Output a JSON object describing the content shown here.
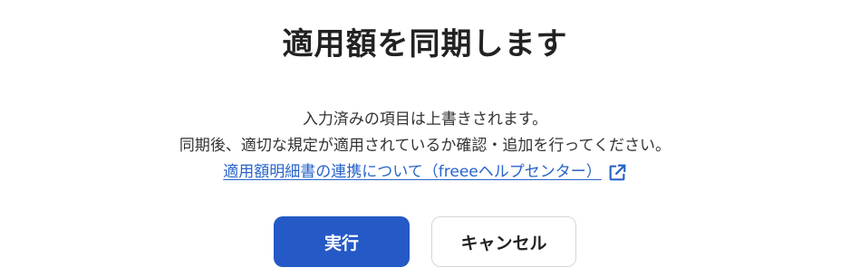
{
  "dialog": {
    "title": "適用額を同期します",
    "message_line1": "入力済みの項目は上書きされます。",
    "message_line2": "同期後、適切な規定が適用されているか確認・追加を行ってください。",
    "help_link_text": "適用額明細書の連携について（freeeヘルプセンター）",
    "help_link_icon": "external-link-icon",
    "execute_label": "実行",
    "cancel_label": "キャンセル"
  },
  "colors": {
    "primary": "#2459c6",
    "link": "#2864c8",
    "text": "#222222"
  }
}
